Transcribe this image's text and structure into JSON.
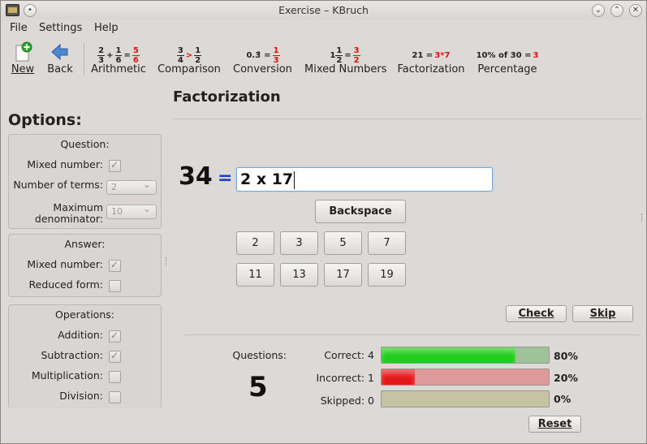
{
  "window": {
    "title": "Exercise – KBruch"
  },
  "menu": [
    "File",
    "Settings",
    "Help"
  ],
  "toolbar": {
    "new_label": "New",
    "back_label": "Back",
    "arithmetic_label": "Arithmetic",
    "comparison_label": "Comparison",
    "conversion_label": "Conversion",
    "mixed_label": "Mixed Numbers",
    "factorization_label": "Factorization",
    "percentage_label": "Percentage",
    "arith_icon": {
      "a_n": "2",
      "a_d": "3",
      "op": "+",
      "b_n": "1",
      "b_d": "6",
      "eq": "=",
      "r_n": "5",
      "r_d": "6"
    },
    "comp_icon": {
      "a_n": "3",
      "a_d": "4",
      "op": ">",
      "b_n": "1",
      "b_d": "2"
    },
    "conv_icon": {
      "left": "0.3̄",
      "eq": "=",
      "r_n": "1",
      "r_d": "3"
    },
    "mixed_icon": {
      "whole": "1",
      "a_n": "1",
      "a_d": "2",
      "eq": "=",
      "r_n": "3",
      "r_d": "2"
    },
    "fact_icon": {
      "left": "21 =",
      "right": "3*7"
    },
    "pct_icon": {
      "left": "10% of 30 =",
      "right": "3"
    }
  },
  "options": {
    "title": "Options:",
    "question": {
      "title": "Question:",
      "mixed_label": "Mixed number:",
      "terms_label": "Number of terms:",
      "terms_value": "2",
      "maxden_label_1": "Maximum",
      "maxden_label_2": "denominator:",
      "maxden_value": "10"
    },
    "answer": {
      "title": "Answer:",
      "mixed_label": "Mixed number:",
      "reduced_label": "Reduced form:"
    },
    "operations": {
      "title": "Operations:",
      "addition": "Addition:",
      "subtraction": "Subtraction:",
      "multiplication": "Multiplication:",
      "division": "Division:"
    }
  },
  "exercise": {
    "title": "Factorization",
    "number": "34",
    "equals": "=",
    "answer_value": "2 x 17",
    "backspace": "Backspace",
    "primes": [
      "2",
      "3",
      "5",
      "7",
      "11",
      "13",
      "17",
      "19"
    ],
    "check": "Check",
    "skip": "Skip"
  },
  "stats": {
    "questions_label": "Questions:",
    "questions_count": "5",
    "correct_label": "Correct: 4",
    "correct_pct": "80%",
    "correct_fraction": 0.8,
    "incorrect_label": "Incorrect: 1",
    "incorrect_pct": "20%",
    "incorrect_fraction": 0.2,
    "skipped_label": "Skipped: 0",
    "skipped_pct": "0%",
    "skipped_fraction": 0,
    "reset": "Reset",
    "colors": {
      "correct": "#22cc1c",
      "incorrect": "#e41818",
      "correct_bg": "#9ec39a",
      "incorrect_bg": "#de9a9a",
      "skipped_bg": "#c5c3a3"
    }
  }
}
